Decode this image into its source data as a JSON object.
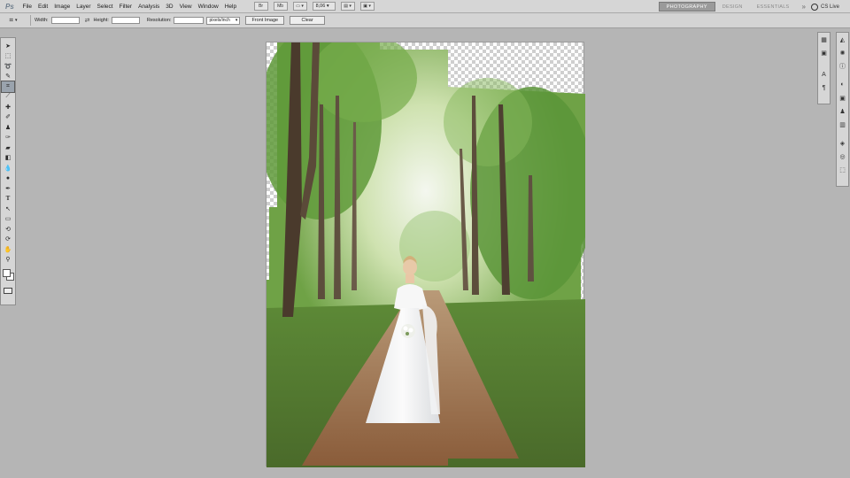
{
  "app": {
    "logo": "Ps"
  },
  "menu": [
    "File",
    "Edit",
    "Image",
    "Layer",
    "Select",
    "Filter",
    "Analysis",
    "3D",
    "View",
    "Window",
    "Help"
  ],
  "appbar": {
    "zoom": "8,06"
  },
  "workspaces": {
    "photography": "PHOTOGRAPHY",
    "design": "DESIGN",
    "essentials": "ESSENTIALS",
    "more": "»",
    "cs_live": "CS Live"
  },
  "options": {
    "width_label": "Width:",
    "height_label": "Height:",
    "resolution_label": "Resolution:",
    "units": "pixels/inch",
    "front_image": "Front Image",
    "clear": "Clear"
  },
  "tools": [
    "move-icon",
    "marquee-icon",
    "lasso-icon",
    "quick-select-icon",
    "crop-icon",
    "eyedropper-icon",
    "healing-brush-icon",
    "brush-icon",
    "clone-stamp-icon",
    "history-brush-icon",
    "eraser-icon",
    "gradient-icon",
    "blur-icon",
    "dodge-icon",
    "pen-icon",
    "type-icon",
    "path-select-icon",
    "shape-icon",
    "3d-rotate-icon",
    "3d-orbit-icon",
    "hand-icon",
    "zoom-icon"
  ],
  "colors": {
    "chrome": "#d6d6d6",
    "workspace_bg": "#b5b5b5",
    "swatch_foreground": "#ffffff",
    "swatch_background": "#ffffff"
  }
}
